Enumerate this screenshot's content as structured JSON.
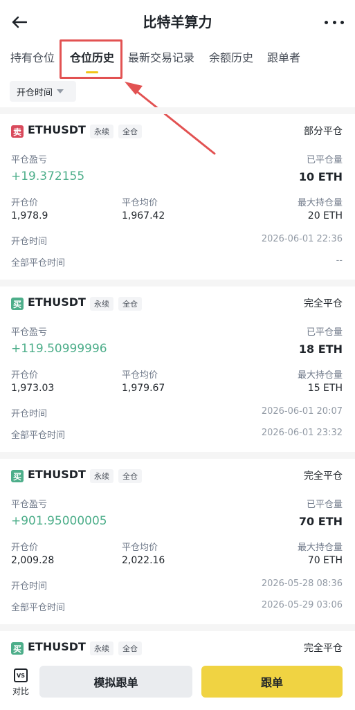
{
  "header": {
    "title": "比特羊算力"
  },
  "tabs": [
    {
      "label": "持有仓位"
    },
    {
      "label": "仓位历史"
    },
    {
      "label": "最新交易记录"
    },
    {
      "label": "余额历史"
    },
    {
      "label": "跟单者"
    }
  ],
  "filter": {
    "label": "开仓时间"
  },
  "colors": {
    "profit": "#4dae8a",
    "accent": "#f0d342",
    "sell": "#d94a5c",
    "annotation": "#e25252"
  },
  "positions": [
    {
      "side": "卖",
      "symbol": "ETHUSDT",
      "tag1": "永续",
      "tag2": "全仓",
      "status": "部分平仓",
      "pnl_label": "平仓盈亏",
      "pnl": "+19.372155",
      "closed_label": "已平仓量",
      "closed": "10 ETH",
      "open_price_label": "开仓价",
      "open_price": "1,978.9",
      "avg_close_label": "平仓均价",
      "avg_close": "1,967.42",
      "max_label": "最大持仓量",
      "max": "20 ETH",
      "open_time_label": "开仓时间",
      "open_time": "2026-06-01 22:36",
      "close_time_label": "全部平仓时间",
      "close_time": "--"
    },
    {
      "side": "买",
      "symbol": "ETHUSDT",
      "tag1": "永续",
      "tag2": "全仓",
      "status": "完全平仓",
      "pnl_label": "平仓盈亏",
      "pnl": "+119.50999996",
      "closed_label": "已平仓量",
      "closed": "18 ETH",
      "open_price_label": "开仓价",
      "open_price": "1,973.03",
      "avg_close_label": "平仓均价",
      "avg_close": "1,979.67",
      "max_label": "最大持仓量",
      "max": "15 ETH",
      "open_time_label": "开仓时间",
      "open_time": "2026-06-01 20:07",
      "close_time_label": "全部平仓时间",
      "close_time": "2026-06-01 23:32"
    },
    {
      "side": "买",
      "symbol": "ETHUSDT",
      "tag1": "永续",
      "tag2": "全仓",
      "status": "完全平仓",
      "pnl_label": "平仓盈亏",
      "pnl": "+901.95000005",
      "closed_label": "已平仓量",
      "closed": "70 ETH",
      "open_price_label": "开仓价",
      "open_price": "2,009.28",
      "avg_close_label": "平仓均价",
      "avg_close": "2,022.16",
      "max_label": "最大持仓量",
      "max": "70 ETH",
      "open_time_label": "开仓时间",
      "open_time": "2026-05-28 08:36",
      "close_time_label": "全部平仓时间",
      "close_time": "2026-05-29 03:06"
    },
    {
      "side": "买",
      "symbol": "ETHUSDT",
      "tag1": "永续",
      "tag2": "全仓",
      "status": "完全平仓"
    }
  ],
  "bottom": {
    "vs_icon": "VS",
    "vs_label": "对比",
    "simulate": "模拟跟单",
    "follow": "跟单"
  }
}
